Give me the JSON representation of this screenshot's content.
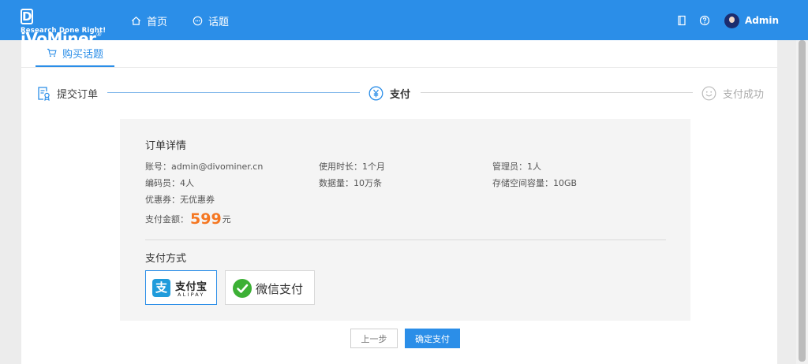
{
  "app": {
    "logo_text": "iVoMiner",
    "logo_letter": "D",
    "logo_reg": "®",
    "logo_tagline": "Research Done Right!",
    "brand_color": "#2b8ee8"
  },
  "nav": {
    "home_label": "首页",
    "topic_label": "话题",
    "home_icon": "home-icon",
    "topic_icon": "chat-icon"
  },
  "user": {
    "name": "Admin",
    "book_icon": "book-icon",
    "help_icon": "help-icon"
  },
  "tab": {
    "label": "购买话题",
    "icon": "cart-icon"
  },
  "steps": [
    {
      "label": "提交订单",
      "icon": "order-form-icon",
      "state": "done"
    },
    {
      "label": "支付",
      "icon": "yen-icon",
      "state": "active"
    },
    {
      "label": "支付成功",
      "icon": "smile-icon",
      "state": "pending"
    }
  ],
  "order": {
    "title": "订单详情",
    "account_label": "账号：",
    "account_value": "admin@divominer.cn",
    "duration_label": "使用时长：",
    "duration_value": "1个月",
    "admins_label": "管理员：",
    "admins_value": "1人",
    "coders_label": "编码员：",
    "coders_value": "4人",
    "data_label": "数据量：",
    "data_value": "10万条",
    "storage_label": "存储空间容量：",
    "storage_value": "10GB",
    "coupon_label": "优惠券：",
    "coupon_value": "无优惠券",
    "amount_label": "支付金额：",
    "amount_value": "599",
    "amount_unit": "元",
    "amount_color": "#f57722"
  },
  "payment": {
    "title": "支付方式",
    "alipay_name": "支付宝",
    "alipay_en": "ALIPAY",
    "alipay_glyph": "支",
    "wechat_name": "微信支付",
    "selected": "alipay"
  },
  "buttons": {
    "prev_label": "上一步",
    "confirm_label": "确定支付"
  }
}
